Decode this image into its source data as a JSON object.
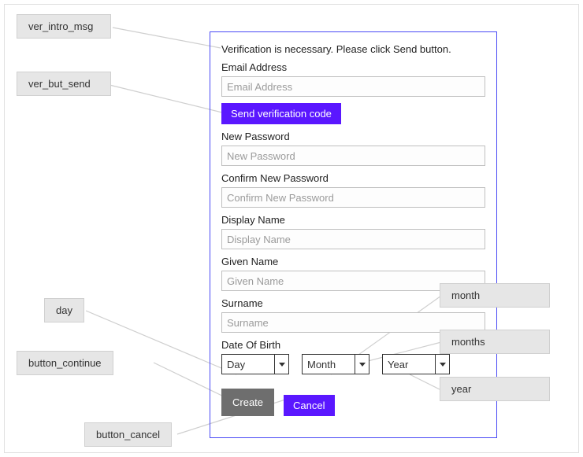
{
  "form": {
    "intro": "Verification is necessary. Please click Send button.",
    "email_label": "Email Address",
    "email_placeholder": "Email Address",
    "send_button": "Send verification code",
    "newpw_label": "New Password",
    "newpw_placeholder": "New Password",
    "confirmpw_label": "Confirm New Password",
    "confirmpw_placeholder": "Confirm New Password",
    "display_label": "Display Name",
    "display_placeholder": "Display Name",
    "given_label": "Given Name",
    "given_placeholder": "Given Name",
    "surname_label": "Surname",
    "surname_placeholder": "Surname",
    "dob_label": "Date Of Birth",
    "dob_day": "Day",
    "dob_month": "Month",
    "dob_year": "Year",
    "create_button": "Create",
    "cancel_button": "Cancel"
  },
  "callouts": {
    "ver_intro_msg": "ver_intro_msg",
    "ver_but_send": "ver_but_send",
    "day": "day",
    "button_continue": "button_continue",
    "button_cancel": "button_cancel",
    "month": "month",
    "months": "months",
    "year": "year"
  }
}
